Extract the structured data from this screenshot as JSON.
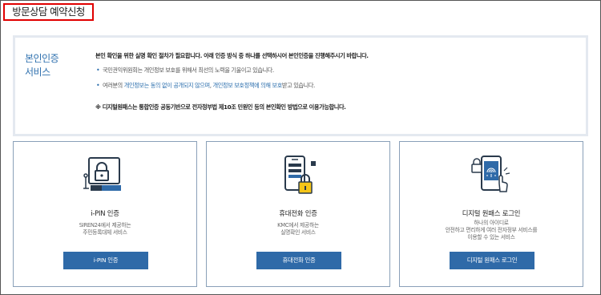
{
  "page": {
    "title": "방문상담 예약신청"
  },
  "info": {
    "heading_line1": "본인인증",
    "heading_line2": "서비스",
    "lead": "본인 확인을 위한 실명 확인 절차가 필요합니다. 아래 인증 방식 중 하나를 선택하시어 본인인증을 진행해주시기 바랍니다.",
    "bullet1": "국민권익위원회는 개인정보 보호를 위해서 최선의 노력을 기울이고 있습니다.",
    "bullet2_pre": "여러분의 ",
    "bullet2_link1": "개인정보는 동의 없이 공개되지 않으며",
    "bullet2_mid": ", ",
    "bullet2_link2": "개인정보 보호정책에 의해 보호",
    "bullet2_post": "받고 있습니다.",
    "note": "※ 디지털원패스는 통합인증 공동기반으로 전자정부법 제10조 민원인 등의 본인확인 방법으로 이용가능합니다."
  },
  "cards": [
    {
      "title": "i-PIN 인증",
      "desc": [
        "SIREN24에서 제공하는",
        "주민등록대체 서비스"
      ],
      "button": "i-PIN 인증",
      "icon": "ipin-monitor-lock-icon"
    },
    {
      "title": "휴대전화 인증",
      "desc": [
        "KMC에서 제공하는",
        "실명확인 서비스"
      ],
      "button": "휴대전화 인증",
      "icon": "mobile-phone-lock-icon"
    },
    {
      "title": "디지털 원패스 로그인",
      "desc": [
        "하나의 아이디로",
        "안전하고 편리하게 여러 전자정부 서비스를",
        "이용할 수 있는 서비스"
      ],
      "button": "디지털 원패스 로그인",
      "icon": "digital-onepass-fingerprint-icon"
    }
  ],
  "colors": {
    "accent": "#2f6aa8",
    "heading_blue": "#2e70ae",
    "title_border": "#e00000",
    "card_border": "#8aa0b8",
    "box_border": "#e4e9f0",
    "icon_dark": "#2a3a4c",
    "icon_yellow": "#f5c518"
  }
}
